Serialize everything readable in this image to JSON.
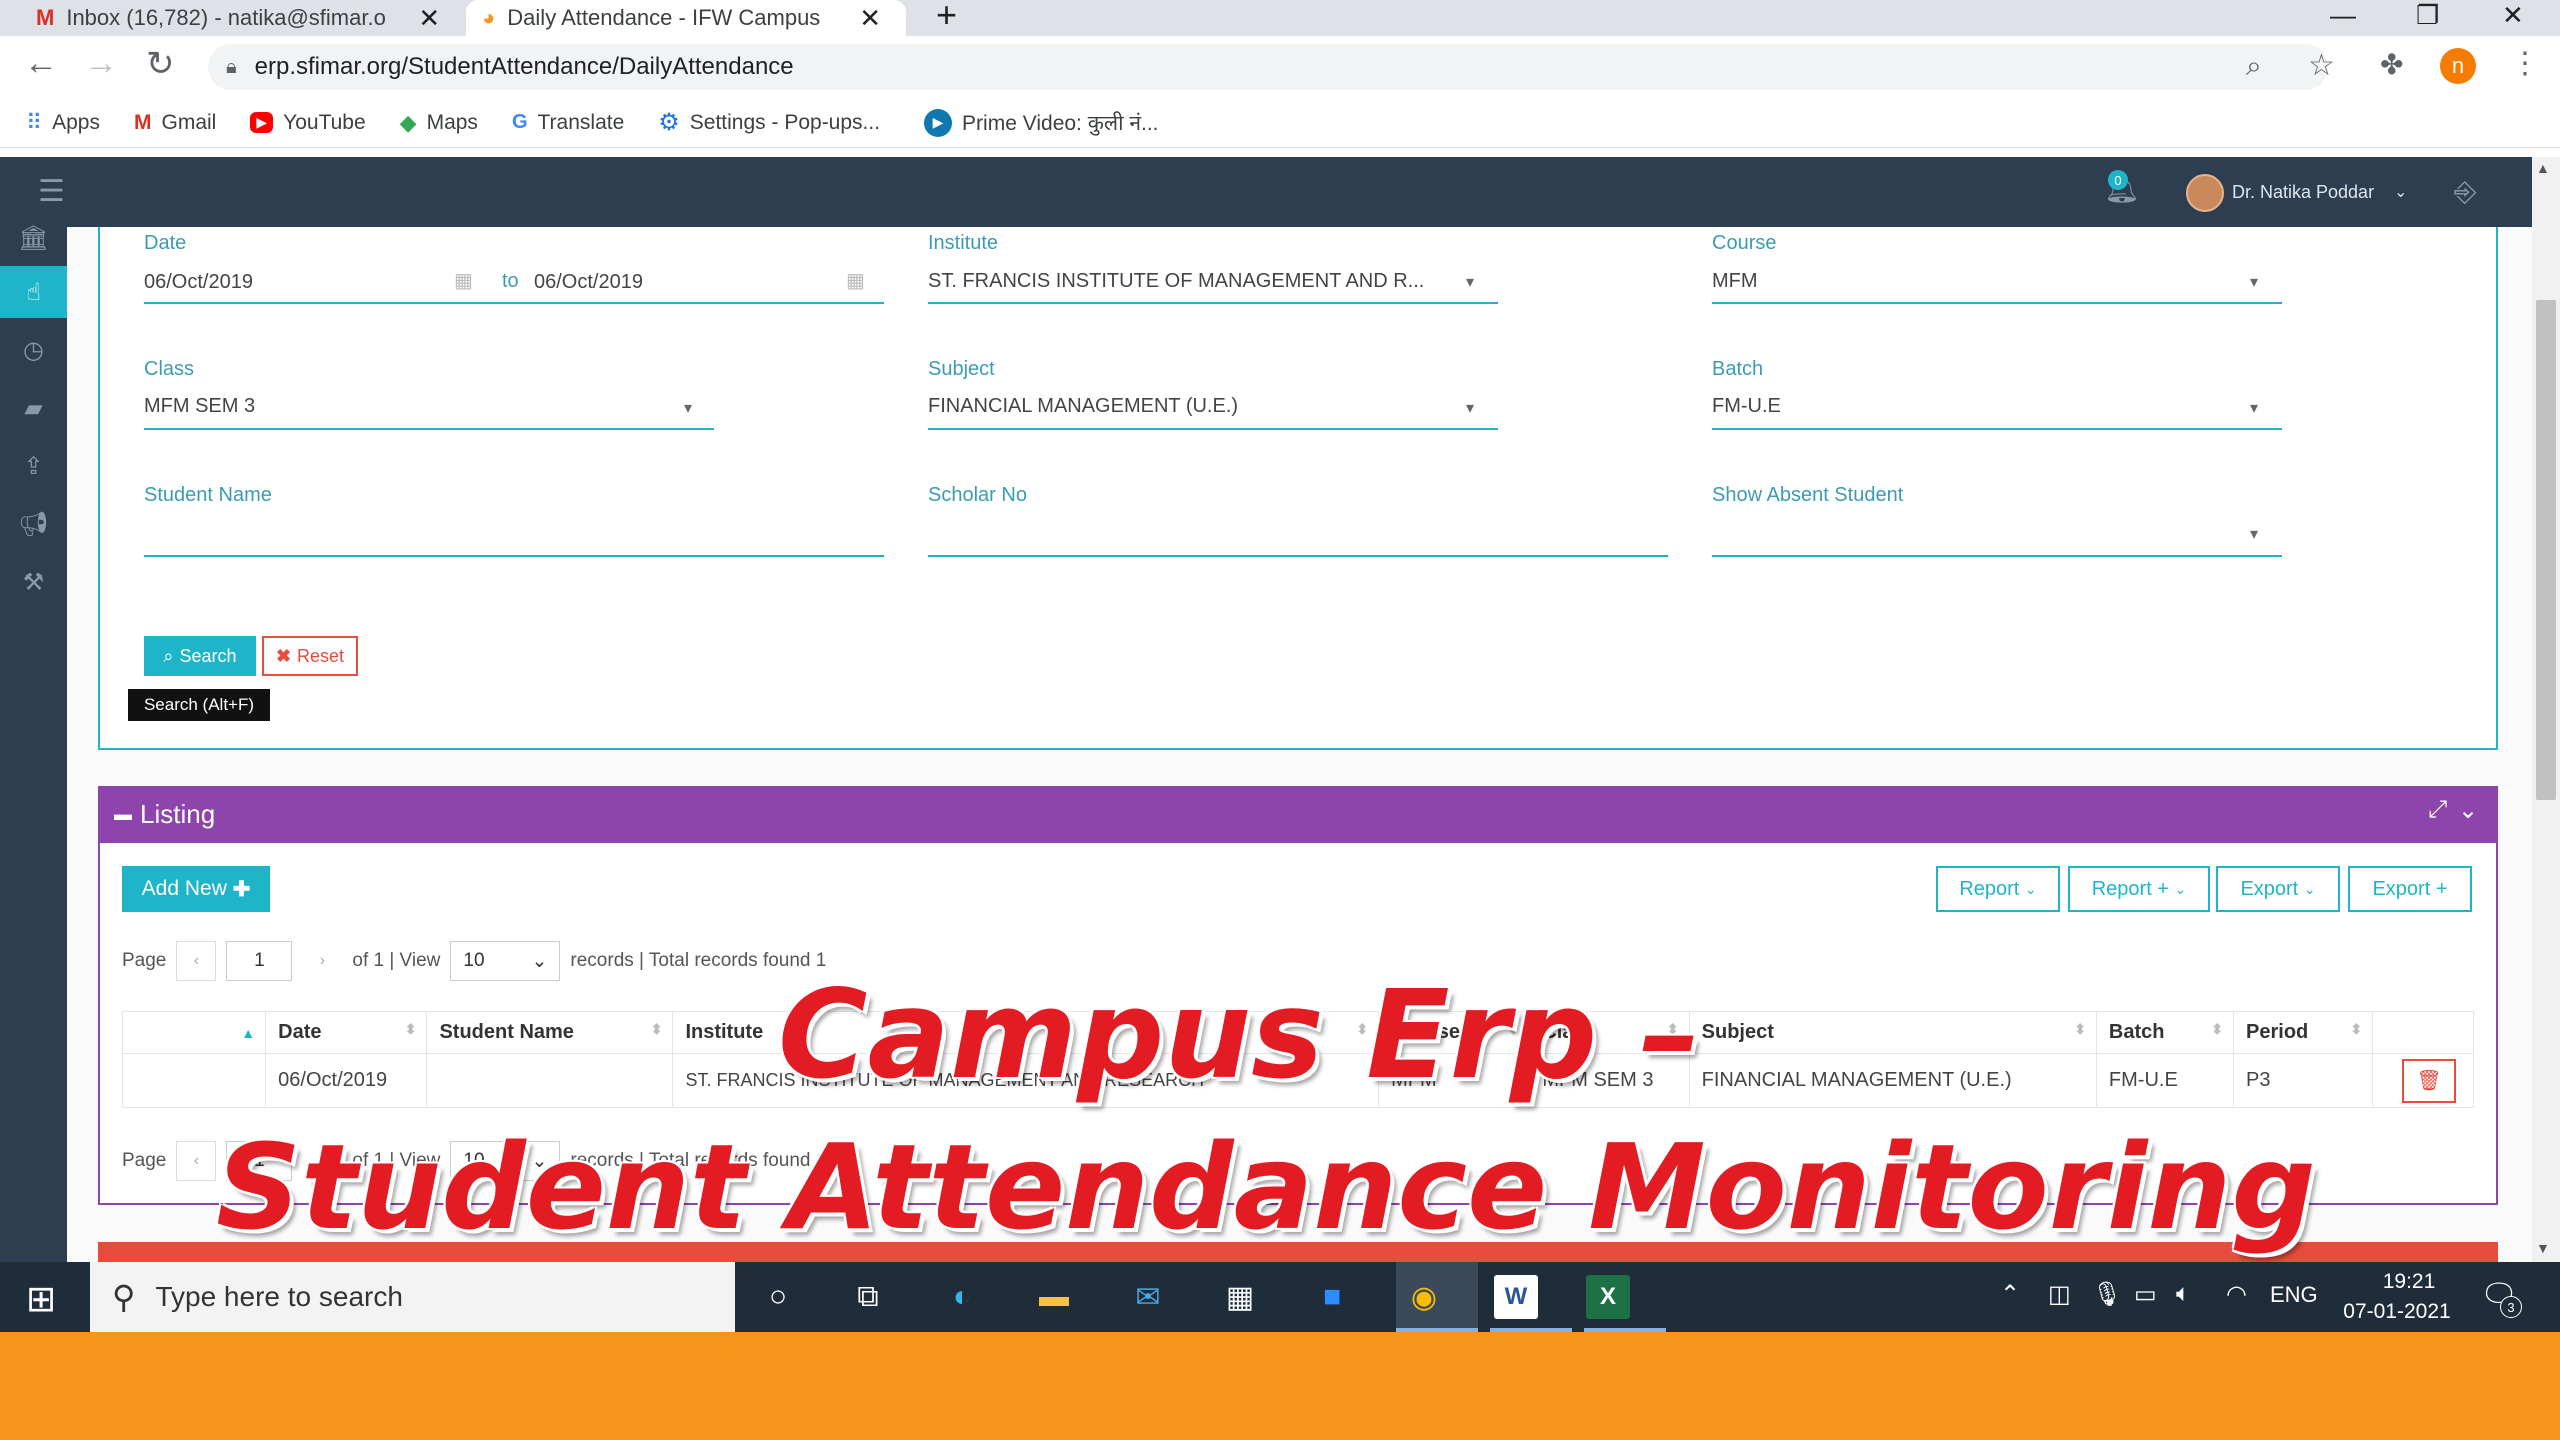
{
  "browser": {
    "tabs": [
      {
        "title": "Inbox (16,782) - natika@sfimar.o"
      },
      {
        "title": "Daily Attendance - IFW Campus"
      }
    ],
    "new_tab": "+",
    "url": "erp.sfimar.org/StudentAttendance/DailyAttendance",
    "profile_initial": "n",
    "bookmarks": [
      {
        "label": "Apps",
        "icon": "apps-grid-icon"
      },
      {
        "label": "Gmail",
        "icon": "gmail-icon"
      },
      {
        "label": "YouTube",
        "icon": "youtube-icon"
      },
      {
        "label": "Maps",
        "icon": "maps-icon"
      },
      {
        "label": "Translate",
        "icon": "translate-icon"
      },
      {
        "label": "Settings - Pop-ups...",
        "icon": "settings-icon"
      },
      {
        "label": "Prime Video: कुली नं...",
        "icon": "prime-video-icon"
      }
    ]
  },
  "app": {
    "notification_count": "0",
    "user_name": "Dr. Natika Poddar"
  },
  "filters": {
    "date_label": "Date",
    "date_from": "06/Oct/2019",
    "date_to_label": "to",
    "date_to": "06/Oct/2019",
    "institute_label": "Institute",
    "institute_value": "ST. FRANCIS INSTITUTE OF MANAGEMENT AND R...",
    "course_label": "Course",
    "course_value": "MFM",
    "class_label": "Class",
    "class_value": "MFM SEM 3",
    "subject_label": "Subject",
    "subject_value": "FINANCIAL MANAGEMENT (U.E.)",
    "batch_label": "Batch",
    "batch_value": "FM-U.E",
    "student_name_label": "Student Name",
    "scholar_no_label": "Scholar No",
    "show_absent_label": "Show Absent Student",
    "search_label": "Search",
    "reset_label": "Reset",
    "search_tooltip": "Search (Alt+F)"
  },
  "listing": {
    "title": "Listing",
    "add_new_label": "Add New",
    "buttons": [
      "Report",
      "Report +",
      "Export",
      "Export +"
    ],
    "pager": {
      "page_label": "Page",
      "page_value": "1",
      "of_text": "of 1 | View",
      "view_value": "10",
      "records_text": "records | Total records found 1"
    },
    "columns": [
      "Date",
      "Student Name",
      "Institute",
      "Course",
      "Class",
      "Subject",
      "Batch",
      "Period"
    ],
    "rows": [
      {
        "date": "06/Oct/2019",
        "student_name": "",
        "institute": "ST. FRANCIS INSTITUTE OF MANAGEMENT AND RESEARCH",
        "course": "MFM",
        "class": "MFM SEM 3",
        "subject": "FINANCIAL MANAGEMENT (U.E.)",
        "batch": "FM-U.E",
        "period": "P3"
      }
    ]
  },
  "taskbar": {
    "search_placeholder": "Type here to search",
    "language": "ENG",
    "time": "19:21",
    "date": "07-01-2021",
    "notification_count": "3"
  },
  "overlay": {
    "line1": "Campus Erp –",
    "line2": "Student Attendance Monitoring"
  }
}
